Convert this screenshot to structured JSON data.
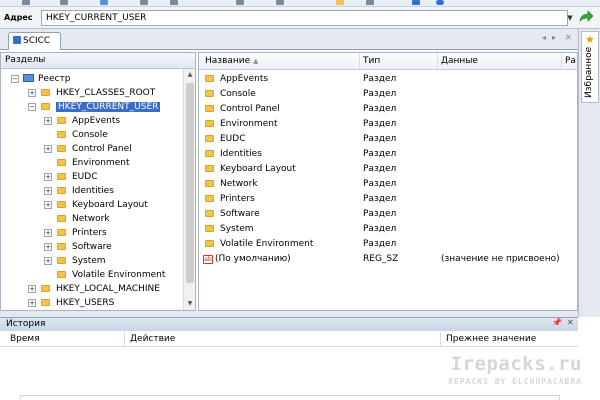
{
  "address": {
    "label": "Адрес",
    "value": "HKEY_CURRENT_USER"
  },
  "tab": {
    "label": "SCICC"
  },
  "favorites": {
    "label": "Избранное"
  },
  "tree": {
    "header": "Разделы",
    "root": "Реестр",
    "items": [
      {
        "label": "HKEY_CLASSES_ROOT"
      },
      {
        "label": "HKEY_CURRENT_USER"
      },
      {
        "label": "AppEvents"
      },
      {
        "label": "Console"
      },
      {
        "label": "Control Panel"
      },
      {
        "label": "Environment"
      },
      {
        "label": "EUDC"
      },
      {
        "label": "Identities"
      },
      {
        "label": "Keyboard Layout"
      },
      {
        "label": "Network"
      },
      {
        "label": "Printers"
      },
      {
        "label": "Software"
      },
      {
        "label": "System"
      },
      {
        "label": "Volatile Environment"
      },
      {
        "label": "HKEY_LOCAL_MACHINE"
      },
      {
        "label": "HKEY_USERS"
      }
    ]
  },
  "list": {
    "columns": {
      "name": "Название",
      "type": "Тип",
      "data": "Данные",
      "extra": "Ра"
    },
    "rows": [
      {
        "name": "AppEvents",
        "type": "Раздел",
        "data": ""
      },
      {
        "name": "Console",
        "type": "Раздел",
        "data": ""
      },
      {
        "name": "Control Panel",
        "type": "Раздел",
        "data": ""
      },
      {
        "name": "Environment",
        "type": "Раздел",
        "data": ""
      },
      {
        "name": "EUDC",
        "type": "Раздел",
        "data": ""
      },
      {
        "name": "Identities",
        "type": "Раздел",
        "data": ""
      },
      {
        "name": "Keyboard Layout",
        "type": "Раздел",
        "data": ""
      },
      {
        "name": "Network",
        "type": "Раздел",
        "data": ""
      },
      {
        "name": "Printers",
        "type": "Раздел",
        "data": ""
      },
      {
        "name": "Software",
        "type": "Раздел",
        "data": ""
      },
      {
        "name": "System",
        "type": "Раздел",
        "data": ""
      },
      {
        "name": "Volatile Environment",
        "type": "Раздел",
        "data": ""
      },
      {
        "name": "(По умолчанию)",
        "type": "REG_SZ",
        "data": "(значение не присвоено)"
      }
    ]
  },
  "history": {
    "title": "История",
    "columns": {
      "time": "Время",
      "action": "Действие",
      "previous": "Прежнее значение"
    }
  },
  "watermark": {
    "line1": "Irepacks.ru",
    "line2": "REPACKS BY ELCHUPACABRA"
  },
  "colors": {
    "selection": "#3b6cc7",
    "folder": "#f2c44e",
    "accent": "#2e73c8"
  }
}
